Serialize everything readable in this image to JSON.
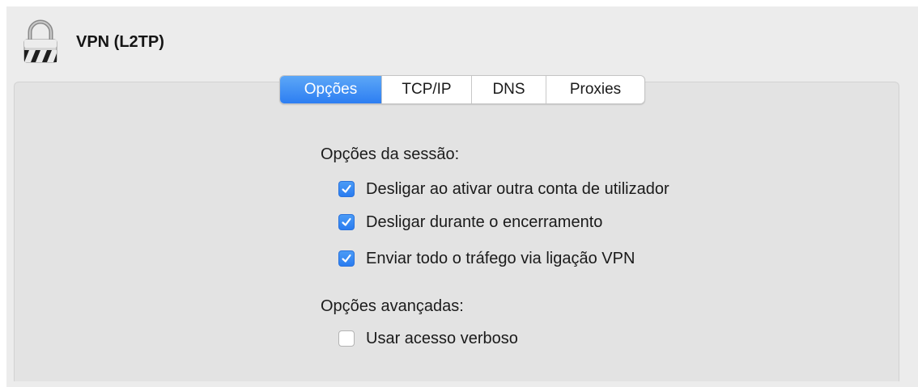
{
  "header": {
    "title": "VPN (L2TP)",
    "icon": "lock-icon"
  },
  "tabs": [
    {
      "label": "Opções",
      "active": true
    },
    {
      "label": "TCP/IP",
      "active": false
    },
    {
      "label": "DNS",
      "active": false
    },
    {
      "label": "Proxies",
      "active": false
    }
  ],
  "session": {
    "label": "Opções da sessão:",
    "options": [
      {
        "label": "Desligar ao ativar outra conta de utilizador",
        "checked": true
      },
      {
        "label": "Desligar durante o encerramento",
        "checked": true
      },
      {
        "label": "Enviar todo o tráfego via ligação VPN",
        "checked": true
      }
    ]
  },
  "advanced": {
    "label": "Opções avançadas:",
    "options": [
      {
        "label": "Usar acesso verboso",
        "checked": false
      }
    ]
  },
  "colors": {
    "accent": "#2d7ef2",
    "window_bg": "#ececec",
    "panel_bg": "#e3e3e3"
  }
}
